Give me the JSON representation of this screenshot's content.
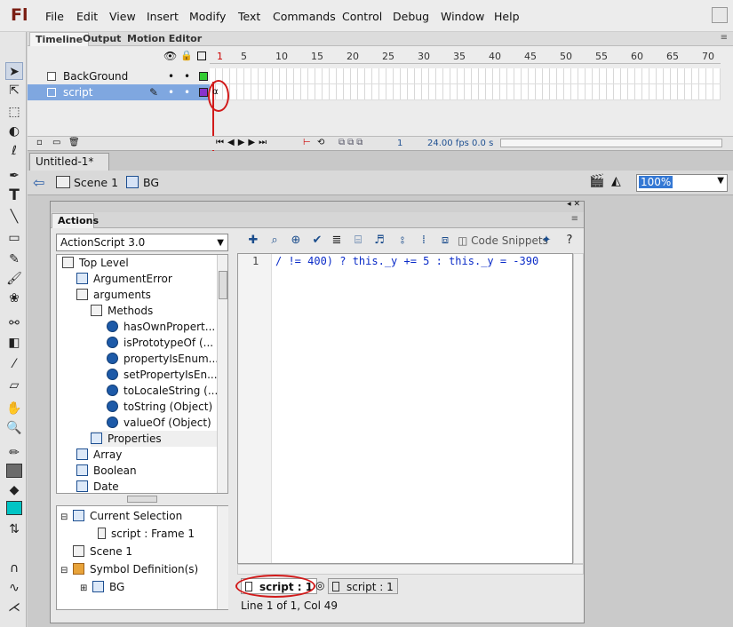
{
  "app": {
    "logo": "Fl"
  },
  "menu": [
    "File",
    "Edit",
    "View",
    "Insert",
    "Modify",
    "Text",
    "Commands",
    "Control",
    "Debug",
    "Window",
    "Help"
  ],
  "timeline": {
    "tabs": [
      "Timeline",
      "Output",
      "Motion Editor"
    ],
    "ruler": [
      "1",
      "5",
      "10",
      "15",
      "20",
      "25",
      "30",
      "35",
      "40",
      "45",
      "50",
      "55",
      "60",
      "65",
      "70"
    ],
    "layers": [
      {
        "name": "BackGround",
        "color": "#33cc33"
      },
      {
        "name": "script",
        "color": "#8833cc",
        "selected": true
      }
    ],
    "bottom": {
      "frame": "1",
      "fps": "24.00 fps",
      "time": "0.0 s"
    }
  },
  "document": {
    "tab": "Untitled-1*",
    "breadcrumb": [
      "Scene 1",
      "BG"
    ],
    "zoom": "100%"
  },
  "actions": {
    "title": "Actions",
    "language": "ActionScript 3.0",
    "code_snippets": "Code Snippets",
    "tree": [
      {
        "label": "Top Level",
        "indent": 0,
        "icon": "book"
      },
      {
        "label": "ArgumentError",
        "indent": 1,
        "icon": "class"
      },
      {
        "label": "arguments",
        "indent": 1,
        "icon": "book"
      },
      {
        "label": "Methods",
        "indent": 2,
        "icon": "book"
      },
      {
        "label": "hasOwnPropert...",
        "indent": 3,
        "icon": "method"
      },
      {
        "label": "isPrototypeOf (...",
        "indent": 3,
        "icon": "method"
      },
      {
        "label": "propertyIsEnum...",
        "indent": 3,
        "icon": "method"
      },
      {
        "label": "setPropertyIsEn...",
        "indent": 3,
        "icon": "method"
      },
      {
        "label": "toLocaleString (...",
        "indent": 3,
        "icon": "method"
      },
      {
        "label": "toString (Object)",
        "indent": 3,
        "icon": "method"
      },
      {
        "label": "valueOf (Object)",
        "indent": 3,
        "icon": "method"
      },
      {
        "label": "Properties",
        "indent": 2,
        "icon": "class"
      },
      {
        "label": "Array",
        "indent": 1,
        "icon": "class"
      },
      {
        "label": "Boolean",
        "indent": 1,
        "icon": "class"
      },
      {
        "label": "Date",
        "indent": 1,
        "icon": "class"
      }
    ],
    "navigator": [
      {
        "label": "Current Selection",
        "indent": 0
      },
      {
        "label": "script : Frame 1",
        "indent": 1
      },
      {
        "label": "Scene 1",
        "indent": 0
      },
      {
        "label": "Symbol Definition(s)",
        "indent": 0
      },
      {
        "label": "BG",
        "indent": 1
      }
    ],
    "editor": {
      "line_number": "1",
      "code": "/ != 400) ? this._y += 5 : this._y = -390"
    },
    "script_tabs": [
      "script : 1",
      "script : 1"
    ],
    "status": "Line 1 of 1, Col 49"
  }
}
